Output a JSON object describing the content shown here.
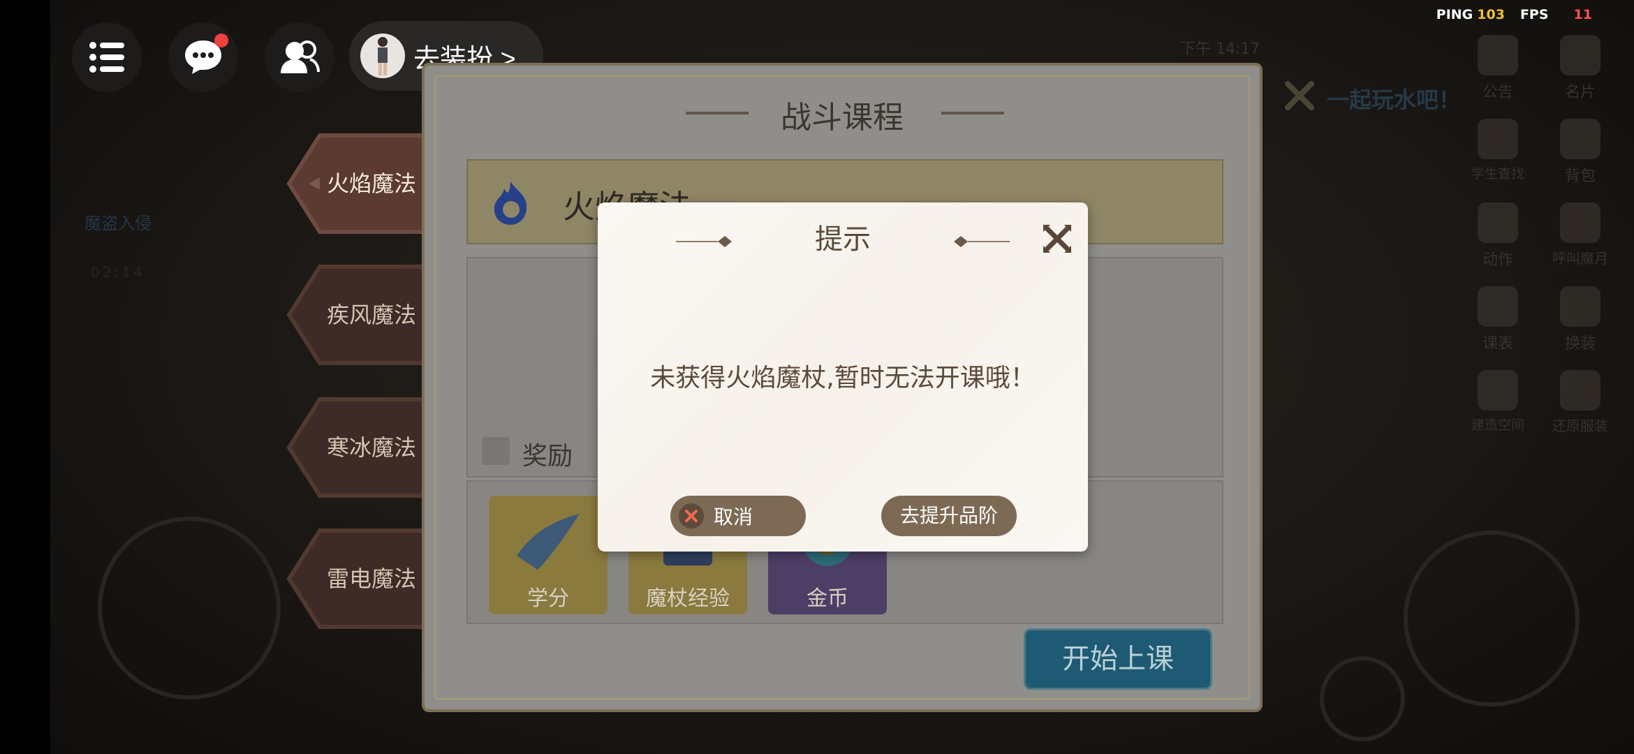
{
  "status": {
    "ping_label": "PING",
    "ping_value": "103",
    "fps_label": "FPS",
    "fps_value": "11"
  },
  "hud": {
    "dress_button": "去装扮 >"
  },
  "background": {
    "time": "下午 14:17",
    "banner": "一起玩水吧！",
    "event_name": "魔盗入侵",
    "event_time": "02:14",
    "right_menu": [
      "公告",
      "名片",
      "学生查找",
      "背包",
      "动作",
      "呼叫魔月",
      "课表",
      "换装",
      "建造空间",
      "还原服装"
    ]
  },
  "tabs": [
    "火焰魔法",
    "疾风魔法",
    "寒冰魔法",
    "雷电魔法"
  ],
  "panel": {
    "title": "战斗课程",
    "course_name": "火焰魔法",
    "reward_label": "奖励",
    "rewards": [
      "学分",
      "魔杖经验",
      "金币"
    ],
    "start_button": "开始上课"
  },
  "dialog": {
    "title": "提示",
    "message": "未获得火焰魔杖,暂时无法开课哦！",
    "cancel_label": "取消",
    "upgrade_label": "去提升品阶"
  }
}
